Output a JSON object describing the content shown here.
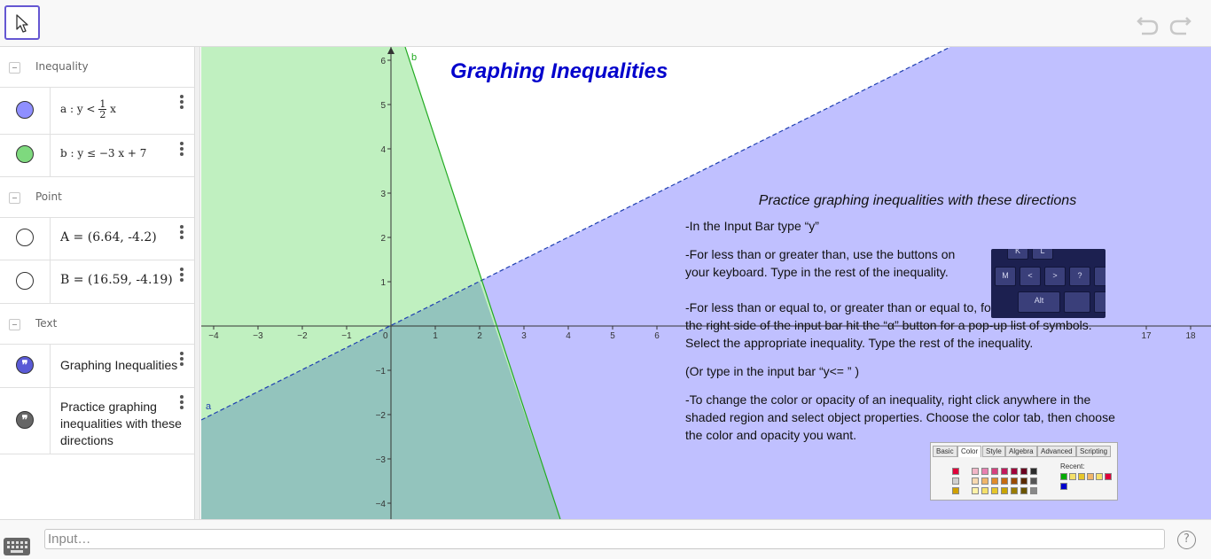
{
  "toolbar": {
    "tools": [
      "move-tool"
    ],
    "icons": {
      "undo": "undo-icon",
      "redo": "redo-icon"
    }
  },
  "algebra": {
    "groups": [
      {
        "label": "Inequality",
        "items": [
          {
            "name": "a",
            "prefix": "a : y <",
            "frac_num": "1",
            "frac_den": "2",
            "suffix": "x",
            "color": "#8f8fff"
          },
          {
            "name": "b",
            "text": "b : y ≤ −3 x + 7",
            "color": "#7ed97e"
          }
        ]
      },
      {
        "label": "Point",
        "items": [
          {
            "name": "A",
            "text": "A = (6.64, -4.2)",
            "color": "#ffffff"
          },
          {
            "name": "B",
            "text": "B = (16.59, -4.19)",
            "color": "#ffffff"
          }
        ]
      },
      {
        "label": "Text",
        "items": [
          {
            "name": "text1",
            "text": "Graphing Inequalities",
            "color": "#5a5ad6"
          },
          {
            "name": "text2",
            "text": "Practice graphing inequalities with these directions",
            "color": "#666666"
          }
        ]
      }
    ]
  },
  "graphics": {
    "title": "Graphing Inequalities",
    "x_ticks": [
      "−4",
      "−3",
      "−2",
      "−1",
      "0",
      "1",
      "2",
      "3",
      "4",
      "5",
      "6",
      "17",
      "18"
    ],
    "y_ticks": [
      "6",
      "5",
      "4",
      "3",
      "2",
      "1",
      "−1",
      "−2",
      "−3",
      "−4"
    ],
    "line_labels": {
      "a": "a",
      "b": "b"
    },
    "colors": {
      "region_a": "#c0c0ff",
      "region_b": "#c0f0c0",
      "overlap": "#93c4bd",
      "line_a": "#1f3fb0",
      "line_b": "#22aa22",
      "title": "#0000cc"
    },
    "directions": {
      "title": "Practice graphing inequalities with these directions",
      "p1": "-In the Input Bar type “y”",
      "p2": "-For less than or greater than, use the buttons on your keyboard.  Type in the rest of the inequality.",
      "p3": "-For less than or equal to, or greater than or equal to, follow these steps: On the right side of the input bar hit the “α” button for a pop-up list of symbols.  Select the appropriate inequality.  Type the rest of the inequality.",
      "p4": "(Or type in the input bar “y<= ” )",
      "p5": "-To change the color or opacity of an inequality, right click anywhere in the shaded region and select object properties.  Choose the color tab, then choose the color and opacity you want."
    },
    "keyboard_keys": [
      "K",
      "L",
      "M",
      "<",
      ">",
      "?",
      "Alt"
    ],
    "dialog_tabs": [
      "Basic",
      "Color",
      "Style",
      "Algebra",
      "Advanced",
      "Scripting"
    ],
    "dialog_recent": "Recent:"
  },
  "inputbar": {
    "placeholder": "Input…",
    "help": "?"
  }
}
